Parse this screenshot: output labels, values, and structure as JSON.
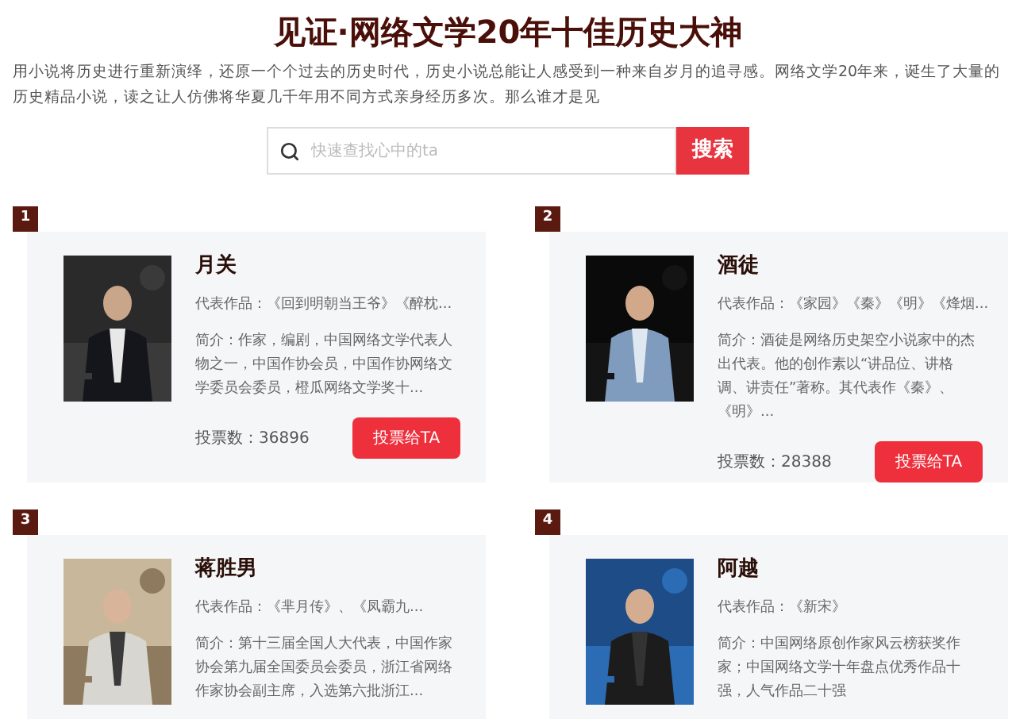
{
  "title": "见证·网络文学20年十佳历史大神",
  "intro": "用小说将历史进行重新演绎，还原一个个过去的历史时代，历史小说总能让人感受到一种来自岁月的追寻感。网络文学20年来，诞生了大量的历史精品小说，读之让人仿佛将华夏几千年用不同方式亲身经历多次。那么谁才是见",
  "search": {
    "placeholder": "快速查找心中的ta",
    "button": "搜索"
  },
  "authors": [
    {
      "rank": "1",
      "name": "月关",
      "works": "代表作品：《回到明朝当王爷》《醉枕...",
      "bio": "简介：作家，编剧，中国网络文学代表人物之一，中国作协会员，中国作协网络文学委员会委员，橙瓜网络文学奖十...",
      "votes": "投票数：36896",
      "vote_button": "投票给TA",
      "kind": "picture"
    },
    {
      "rank": "2",
      "name": "酒徒",
      "works": "代表作品：《家园》《秦》《明》《烽烟...",
      "bio": "简介：酒徒是网络历史架空小说家中的杰出代表。他的创作素以“讲品位、讲格调、讲责任”著称。其代表作《秦》、《明》...",
      "votes": "投票数：28388",
      "vote_button": "投票给TA",
      "kind": "picture"
    },
    {
      "rank": "3",
      "name": "蒋胜男",
      "works": "代表作品：《芈月传》、《凤霸九...",
      "bio": "简介：第十三届全国人大代表，中国作家协会第九届全国委员会委员，浙江省网络作家协会副主席，入选第六批浙江...",
      "kind": "picture"
    },
    {
      "rank": "4",
      "name": "阿越",
      "works": "代表作品：《新宋》",
      "bio": "简介：中国网络原创作家风云榜获奖作家；中国网络文学十年盘点优秀作品十强，人气作品二十强",
      "kind": "picture"
    }
  ]
}
